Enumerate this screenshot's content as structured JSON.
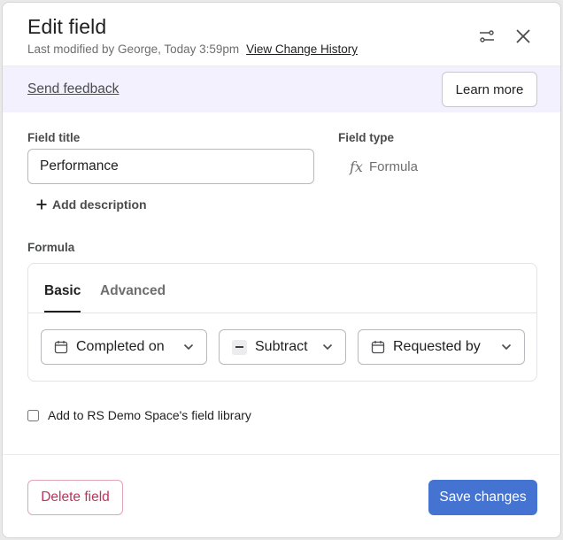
{
  "dialog": {
    "title": "Edit field",
    "modified_text": "Last modified by George, Today 3:59pm",
    "history_link": "View Change History"
  },
  "feedback": {
    "link": "Send feedback",
    "learn_more": "Learn more"
  },
  "fields": {
    "title_label": "Field title",
    "title_value": "Performance",
    "type_label": "Field type",
    "type_icon": "fx",
    "type_value": "Formula",
    "add_description": "Add description"
  },
  "formula": {
    "label": "Formula",
    "tabs": [
      {
        "label": "Basic",
        "active": true
      },
      {
        "label": "Advanced",
        "active": false
      }
    ],
    "operand1": "Completed on",
    "operator": "Subtract",
    "operand2": "Requested by"
  },
  "library": {
    "label": "Add to RS Demo Space's field library",
    "checked": false
  },
  "footer": {
    "delete": "Delete field",
    "save": "Save changes"
  },
  "colors": {
    "primary": "#4573d2",
    "danger": "#c0325a",
    "feedback_bg": "#f3f1fd"
  }
}
